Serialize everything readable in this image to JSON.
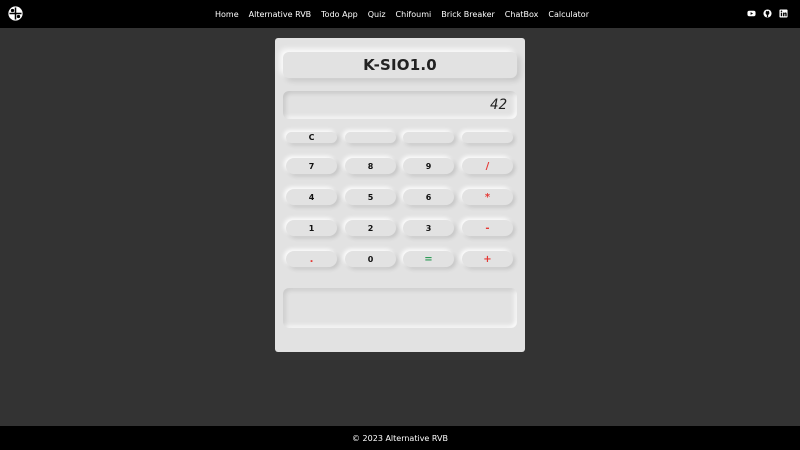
{
  "nav": {
    "logo_icon": "rvb-logo-icon",
    "links": [
      "Home",
      "Alternative RVB",
      "Todo App",
      "Quiz",
      "Chifoumi",
      "Brick Breaker",
      "ChatBox",
      "Calculator"
    ],
    "social_icons": [
      "youtube-icon",
      "github-icon",
      "linkedin-icon"
    ]
  },
  "calculator": {
    "title": "K-SIO1.0",
    "display_value": "42",
    "keys": {
      "clear": "C",
      "empty_1": "",
      "empty_2": "",
      "empty_3": "",
      "k7": "7",
      "k8": "8",
      "k9": "9",
      "divide": "/",
      "k4": "4",
      "k5": "5",
      "k6": "6",
      "multiply": "*",
      "k1": "1",
      "k2": "2",
      "k3": "3",
      "minus": "-",
      "dot": ".",
      "k0": "0",
      "equals": "=",
      "plus": "+"
    },
    "history": ""
  },
  "footer": {
    "text": "© 2023 Alternative RVB"
  },
  "colors": {
    "background": "#333333",
    "bar": "#000000",
    "panel": "#e2e2e2",
    "operator": "#e53935",
    "equals": "#2e9b57"
  }
}
